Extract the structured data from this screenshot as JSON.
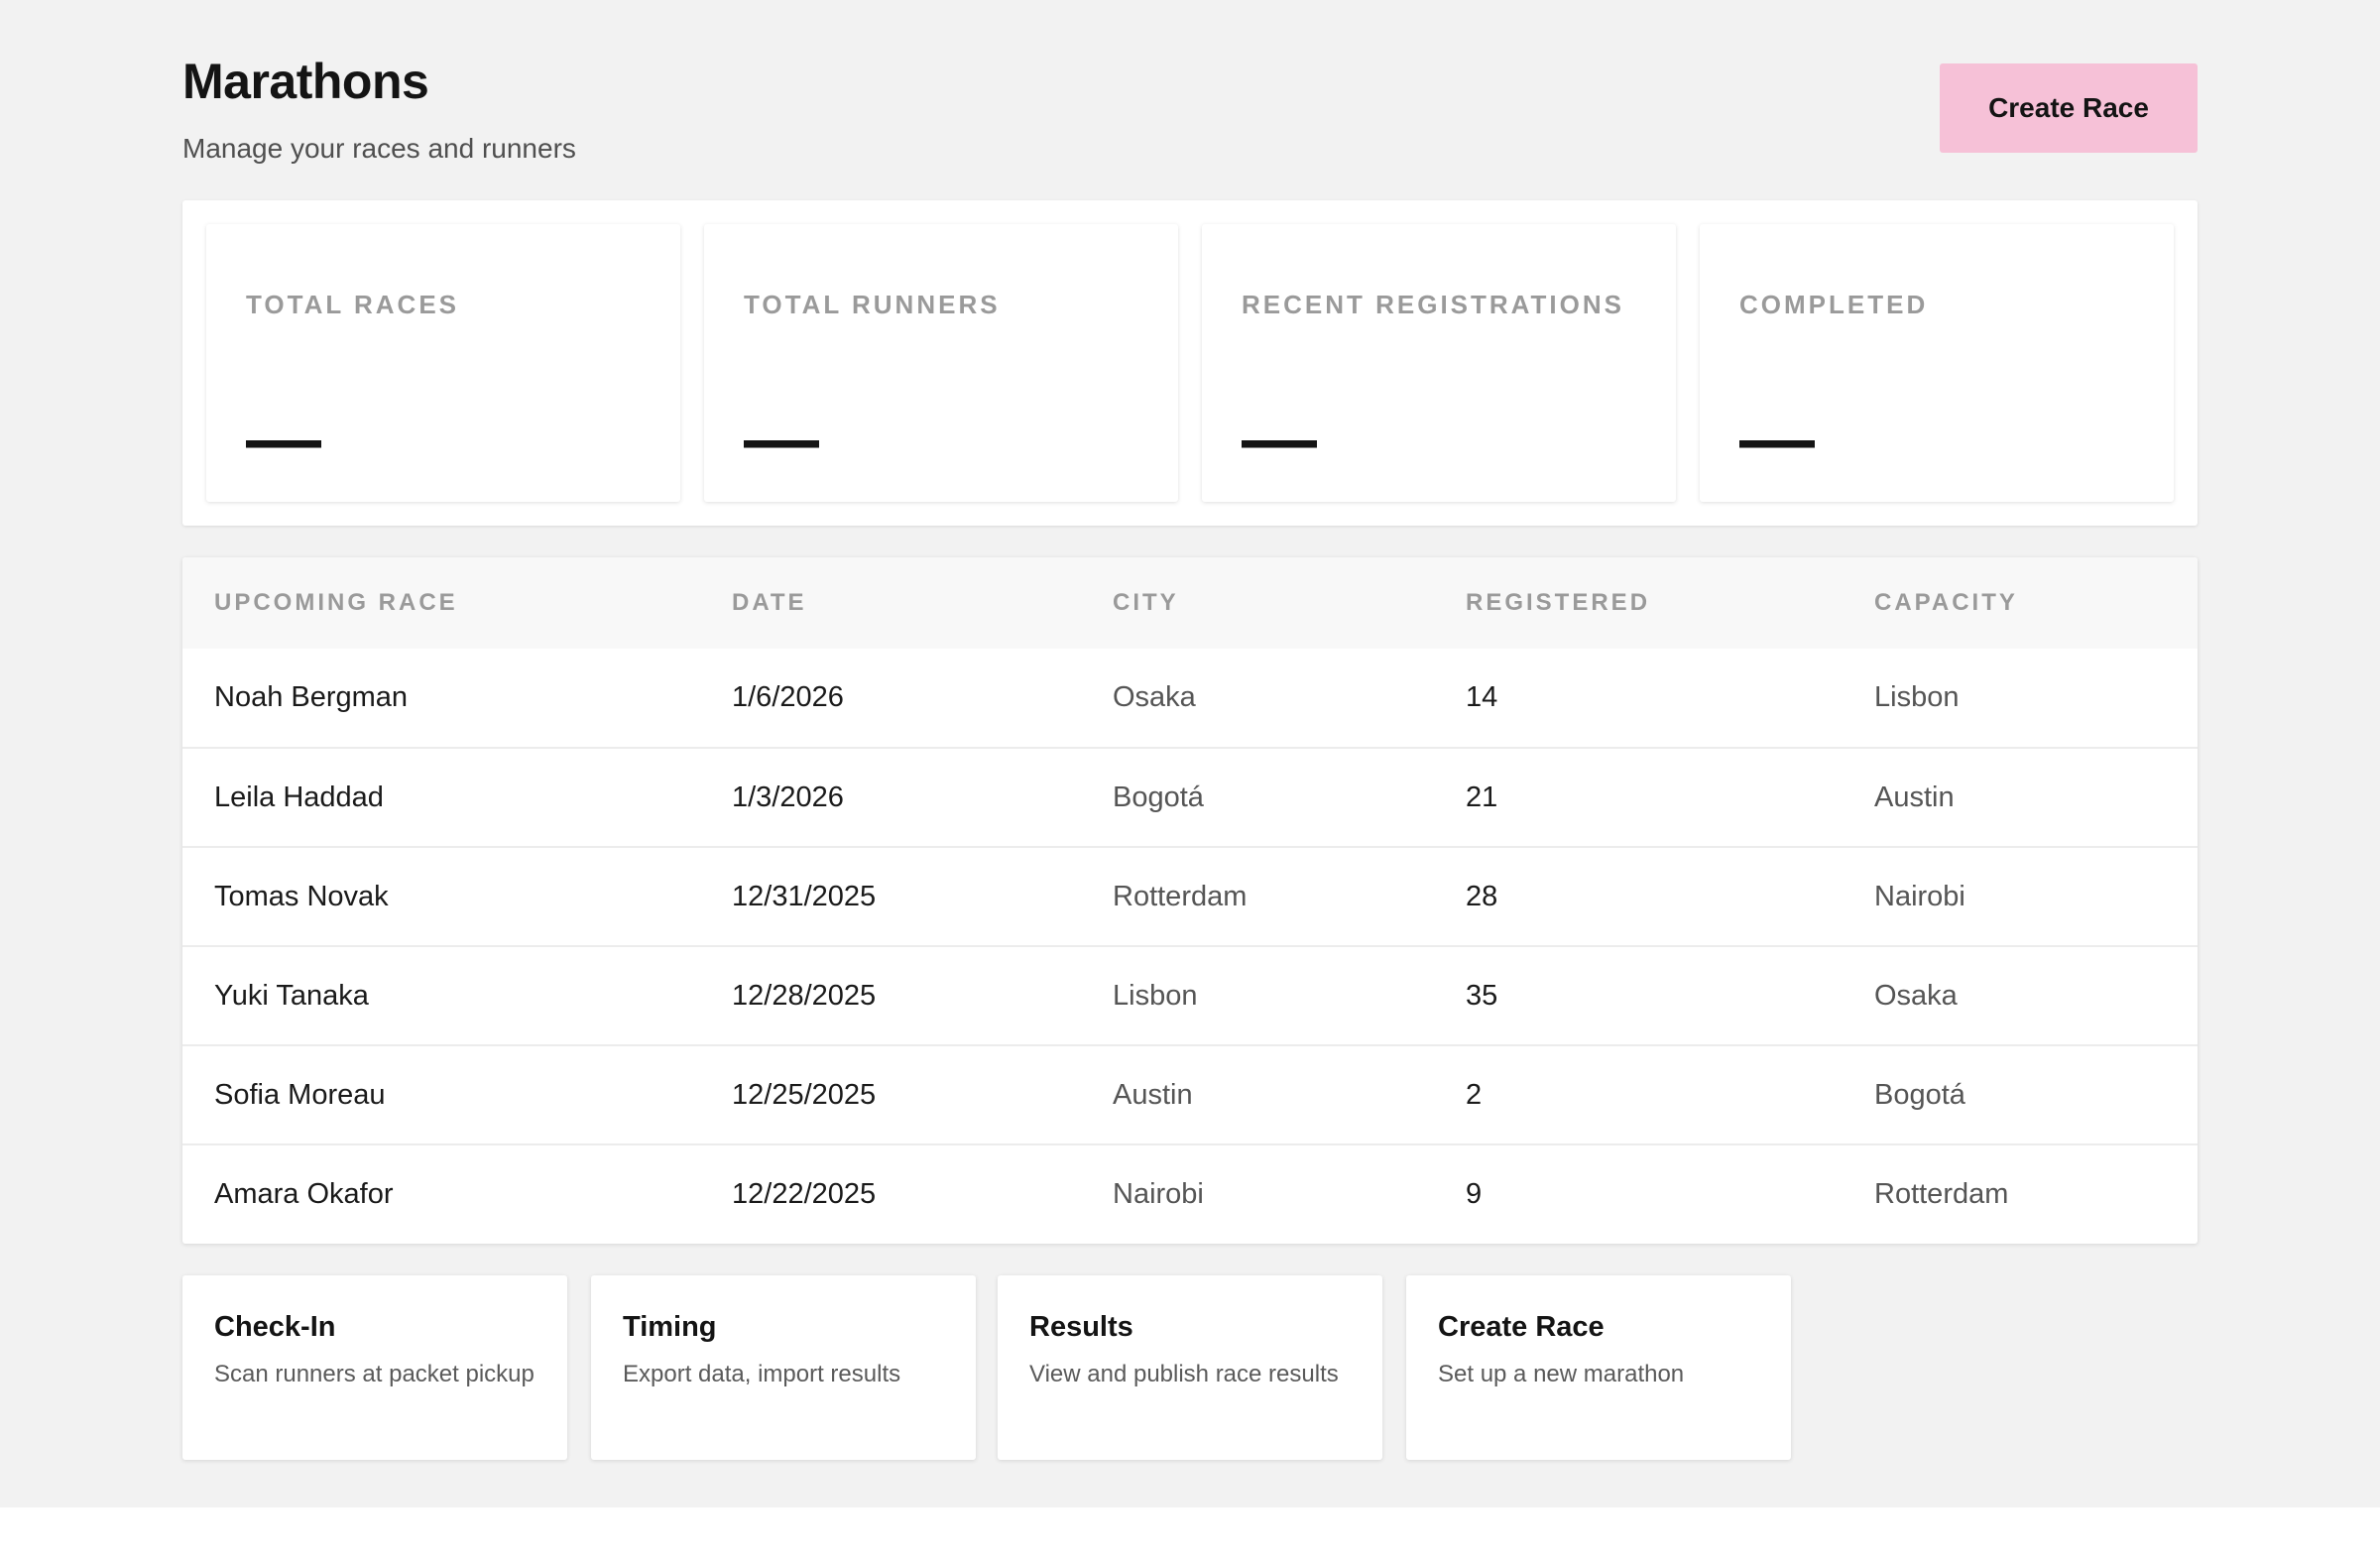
{
  "header": {
    "title": "Marathons",
    "subtitle": "Manage your races and runners",
    "create_button_label": "Create Race"
  },
  "stats": [
    {
      "label": "TOTAL RACES",
      "value": "—"
    },
    {
      "label": "TOTAL RUNNERS",
      "value": "—"
    },
    {
      "label": "RECENT REGISTRATIONS",
      "value": "—"
    },
    {
      "label": "COMPLETED",
      "value": "—"
    }
  ],
  "table": {
    "columns": [
      "UPCOMING RACE",
      "DATE",
      "CITY",
      "REGISTERED",
      "CAPACITY"
    ],
    "rows": [
      [
        "Noah Bergman",
        "1/6/2026",
        "Osaka",
        "14",
        "Lisbon"
      ],
      [
        "Leila Haddad",
        "1/3/2026",
        "Bogotá",
        "21",
        "Austin"
      ],
      [
        "Tomas Novak",
        "12/31/2025",
        "Rotterdam",
        "28",
        "Nairobi"
      ],
      [
        "Yuki Tanaka",
        "12/28/2025",
        "Lisbon",
        "35",
        "Osaka"
      ],
      [
        "Sofia Moreau",
        "12/25/2025",
        "Austin",
        "2",
        "Bogotá"
      ],
      [
        "Amara Okafor",
        "12/22/2025",
        "Nairobi",
        "9",
        "Rotterdam"
      ]
    ]
  },
  "actions": [
    {
      "title": "Check-In",
      "description": "Scan runners at packet pickup"
    },
    {
      "title": "Timing",
      "description": "Export data, import results"
    },
    {
      "title": "Results",
      "description": "View and publish race results"
    },
    {
      "title": "Create Race",
      "description": "Set up a new marathon"
    }
  ],
  "colors": {
    "page_background": "#f2f2f2",
    "accent_button": "#f6c1d7",
    "muted_text": "#9a9a9a"
  }
}
